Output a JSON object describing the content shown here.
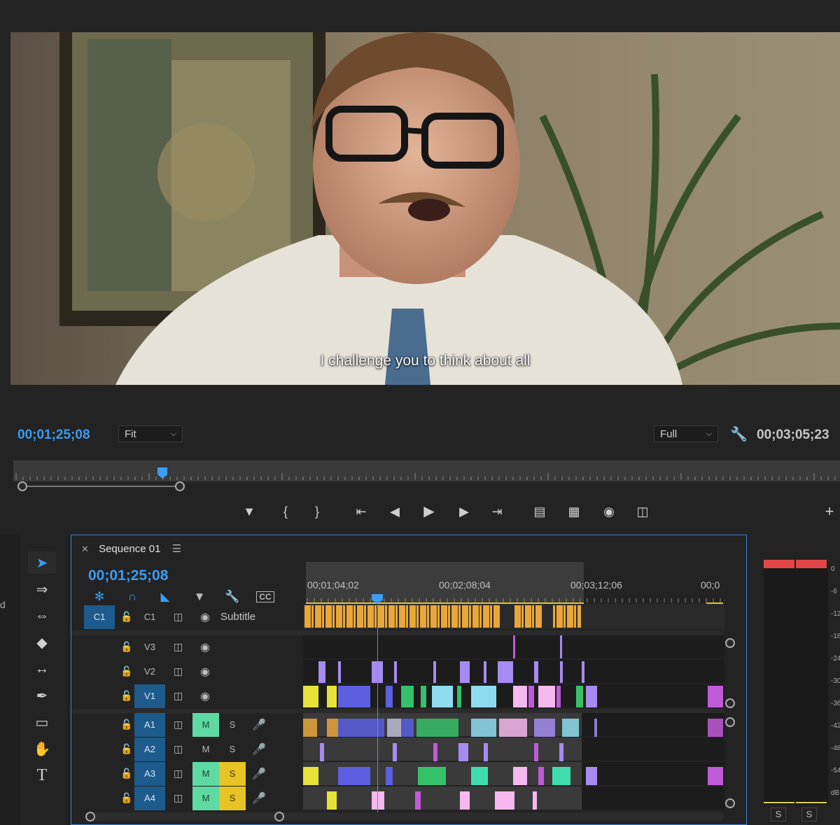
{
  "monitor": {
    "subtitle": "I challenge you to think about all",
    "current_timecode": "00;01;25;08",
    "fit_dropdown": "Fit",
    "quality_dropdown": "Full",
    "duration_timecode": "00;03;05;23"
  },
  "timeline": {
    "tab_title": "Sequence 01",
    "timecode": "00;01;25;08",
    "ruler_labels": [
      "00;01;04;02",
      "00;02;08;04",
      "00;03;12;06",
      "00;0"
    ],
    "caption_track": {
      "left_label": "C1",
      "name_label": "C1",
      "title": "Subtitle"
    },
    "tracks": [
      {
        "name": "V3",
        "active": false,
        "type": "video"
      },
      {
        "name": "V2",
        "active": false,
        "type": "video"
      },
      {
        "name": "V1",
        "active": true,
        "type": "video"
      },
      {
        "name": "A1",
        "active": true,
        "type": "audio",
        "mute": true,
        "solo": false
      },
      {
        "name": "A2",
        "active": true,
        "type": "audio",
        "mute": false,
        "solo": false
      },
      {
        "name": "A3",
        "active": true,
        "type": "audio",
        "mute": true,
        "solo": true
      },
      {
        "name": "A4",
        "active": true,
        "type": "audio",
        "mute": true,
        "solo": true
      }
    ],
    "mute_label": "M",
    "solo_label": "S"
  },
  "meter": {
    "scale": [
      "0",
      "-6",
      "-12",
      "-18",
      "-24",
      "-30",
      "-36",
      "-42",
      "-48",
      "-54",
      "dB"
    ],
    "solo_left": "S",
    "solo_right": "S"
  },
  "colors": {
    "accent": "#3b9cf0",
    "caption_clip": "#e9a73a",
    "mute_on": "#5fd9a2",
    "solo_on": "#e7c326",
    "track_active": "#1d5b8c"
  }
}
